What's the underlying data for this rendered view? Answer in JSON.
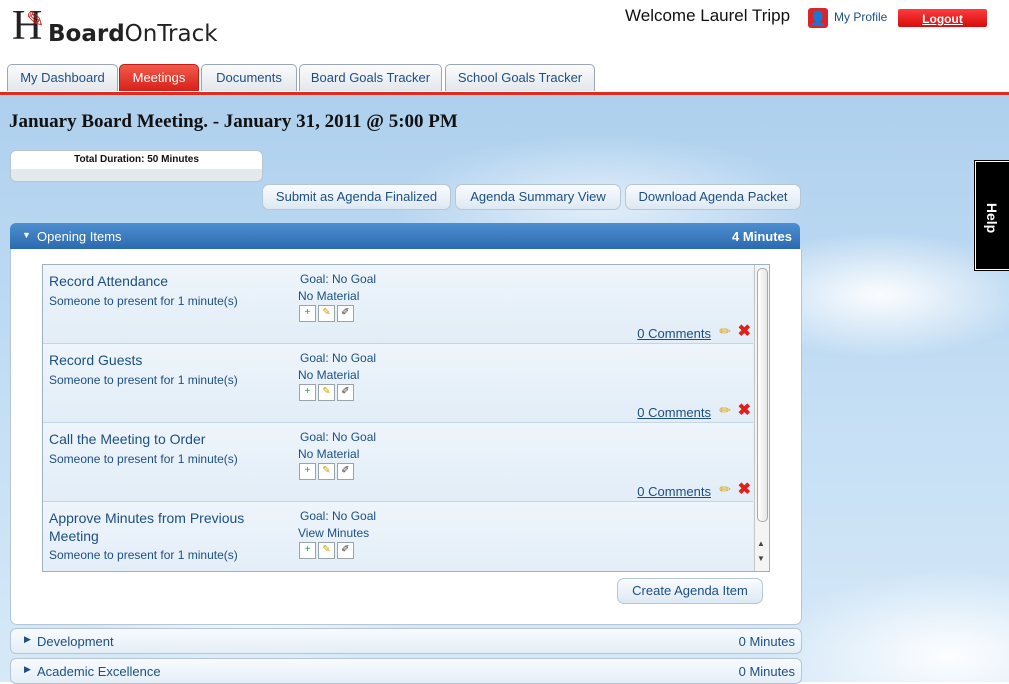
{
  "app": {
    "logo_text": "BoardOnTrack"
  },
  "header": {
    "welcome": "Welcome Laurel Tripp",
    "my_profile": "My Profile",
    "logout": "Logout"
  },
  "tabs": [
    {
      "label": "My Dashboard",
      "active": false
    },
    {
      "label": "Meetings",
      "active": true
    },
    {
      "label": "Documents",
      "active": false
    },
    {
      "label": "Board Goals Tracker",
      "active": false
    },
    {
      "label": "School Goals Tracker",
      "active": false
    }
  ],
  "page": {
    "title": "January Board Meeting. - January 31, 2011 @ 5:00 PM",
    "total_duration": "Total Duration: 50 Minutes"
  },
  "actions": {
    "submit": "Submit as Agenda Finalized",
    "summary": "Agenda Summary View",
    "download": "Download Agenda Packet"
  },
  "sections": [
    {
      "title": "Opening Items",
      "minutes": "4 Minutes",
      "expanded": true,
      "items": [
        {
          "name": "Record Attendance",
          "presenter": "Someone to present for 1 minute(s)",
          "goal": "Goal: No Goal",
          "material": "No Material",
          "comments": "0 Comments"
        },
        {
          "name": "Record Guests",
          "presenter": "Someone to present for 1 minute(s)",
          "goal": "Goal: No Goal",
          "material": "No Material",
          "comments": "0 Comments"
        },
        {
          "name": "Call the Meeting to Order",
          "presenter": "Someone to present for 1 minute(s)",
          "goal": "Goal: No Goal",
          "material": "No Material",
          "comments": "0 Comments"
        },
        {
          "name": "Approve Minutes from Previous Meeting",
          "presenter": "Someone to present for 1 minute(s)",
          "goal": "Goal: No Goal",
          "material": "View Minutes",
          "comments": ""
        }
      ],
      "create_label": "Create Agenda Item"
    },
    {
      "title": "Development",
      "minutes": "0 Minutes",
      "expanded": false
    },
    {
      "title": "Academic Excellence",
      "minutes": "0 Minutes",
      "expanded": false
    }
  ],
  "help": {
    "label": "Help"
  },
  "colors": {
    "accent_red": "#e02b20",
    "section_blue": "#2a68ad",
    "link_blue": "#1d4f86"
  }
}
